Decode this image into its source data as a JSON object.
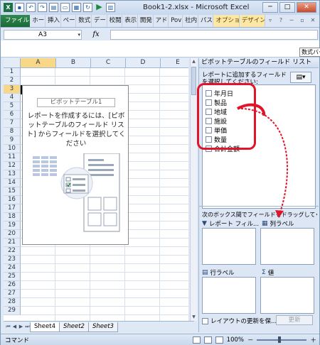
{
  "titlebar": {
    "title": "Book1-2.xlsx - Microsoft Excel",
    "qat_icons": [
      "excel-logo-icon",
      "save-icon",
      "undo-icon",
      "redo-icon",
      "print-preview-icon",
      "open-icon",
      "format-icon",
      "refresh-icon",
      "run-icon",
      "table-icon"
    ],
    "window_buttons": [
      "─",
      "□",
      "✕"
    ]
  },
  "ribbon": {
    "tabs": [
      {
        "label": "ファイル",
        "kind": "file"
      },
      {
        "label": "ホー"
      },
      {
        "label": "挿入"
      },
      {
        "label": "ペー"
      },
      {
        "label": "数式"
      },
      {
        "label": "デー"
      },
      {
        "label": "校閲"
      },
      {
        "label": "表示"
      },
      {
        "label": "開発"
      },
      {
        "label": "アド"
      },
      {
        "label": "Pov"
      },
      {
        "label": "社内"
      },
      {
        "label": "パス"
      },
      {
        "label": "オプショ",
        "kind": "pivot"
      },
      {
        "label": "デザイン",
        "kind": "pivot"
      }
    ]
  },
  "formula_bar": {
    "name_box": "A3",
    "fx_label": "fx",
    "formula": "",
    "tooltip": "数式バー"
  },
  "grid": {
    "columns": [
      "A",
      "B",
      "C",
      "D",
      "E"
    ],
    "selected_column": "A",
    "rows": [
      "1",
      "2",
      "3",
      "4",
      "5",
      "6",
      "7",
      "8",
      "9",
      "10",
      "11",
      "12",
      "13",
      "14",
      "15",
      "16",
      "17",
      "18",
      "19",
      "20",
      "21",
      "22",
      "23",
      "24",
      "25",
      "26",
      "27",
      "28",
      "29"
    ],
    "selected_row": "3"
  },
  "pivot_placeholder": {
    "title": "ピボットテーブル1",
    "message": "レポートを作成するには、[ピボットテーブルのフィールド リスト] からフィールドを選択してください"
  },
  "sheet_tabs": [
    "Sheet4",
    "Sheet2",
    "Sheet3"
  ],
  "active_sheet": "Sheet4",
  "status": {
    "mode": "コマンド",
    "zoom": "100%",
    "zoom_minus": "－",
    "zoom_plus": "＋"
  },
  "field_pane": {
    "header": "ピボットテーブルのフィールド リスト",
    "close": "✕",
    "subtitle": "レポートに追加するフィールドを選択してください:",
    "fields": [
      "年月日",
      "製品",
      "地域",
      "施設",
      "単価",
      "数量",
      "合計金額"
    ],
    "drag_label": "次のボックス間でフィールドをドラッグしてください:",
    "areas": {
      "filter": "レポート フィル...",
      "columns": "列ラベル",
      "rows": "行ラベル",
      "values": "値"
    },
    "defer_label": "レイアウトの更新を保...",
    "update_button": "更新"
  },
  "accent": {
    "annotation_red": "#e0142a",
    "file_tab_green": "#1e7145",
    "selection_gold": "#f8d887"
  }
}
